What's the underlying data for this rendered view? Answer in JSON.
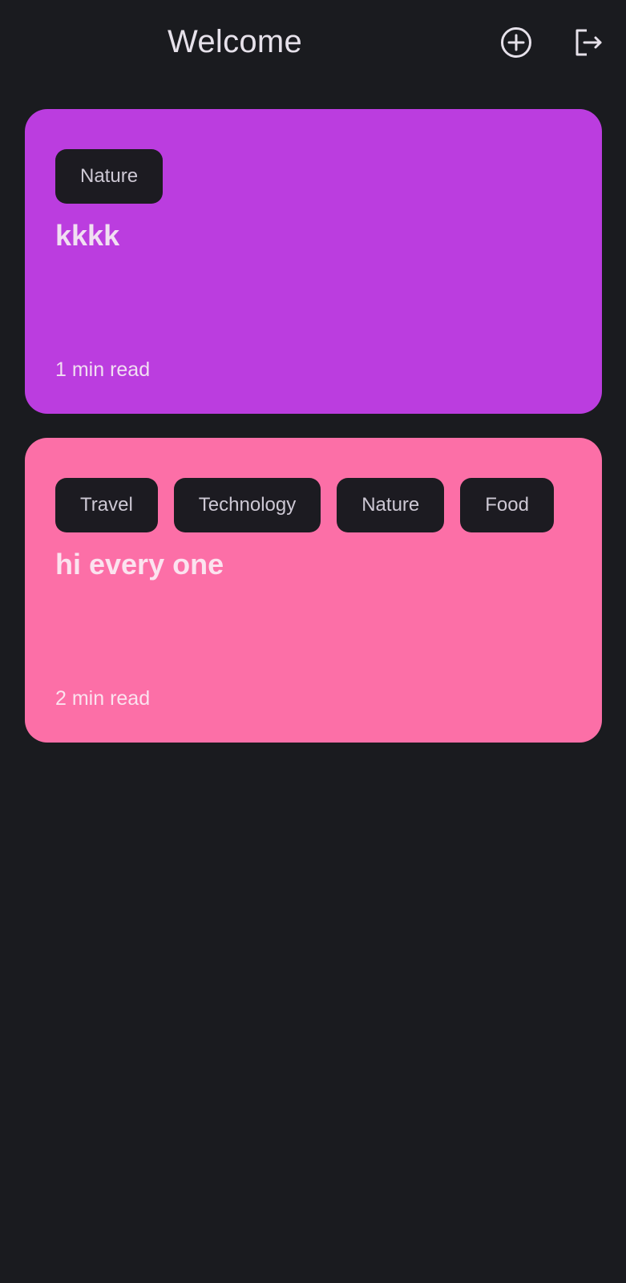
{
  "header": {
    "title": "Welcome",
    "add_icon": "add-circle-icon",
    "logout_icon": "logout-icon"
  },
  "colors": {
    "background": "#1a1b1f",
    "card_purple": "#bb3ddf",
    "card_pink": "#fc6fa7",
    "tag_background": "#1c1b21"
  },
  "posts": [
    {
      "color": "#bb3ddf",
      "tags": [
        "Nature"
      ],
      "title": "kkkk",
      "read_time": "1 min read"
    },
    {
      "color": "#fc6fa7",
      "tags": [
        "Travel",
        "Technology",
        "Nature",
        "Food"
      ],
      "title": "hi every one",
      "read_time": "2 min read"
    }
  ]
}
